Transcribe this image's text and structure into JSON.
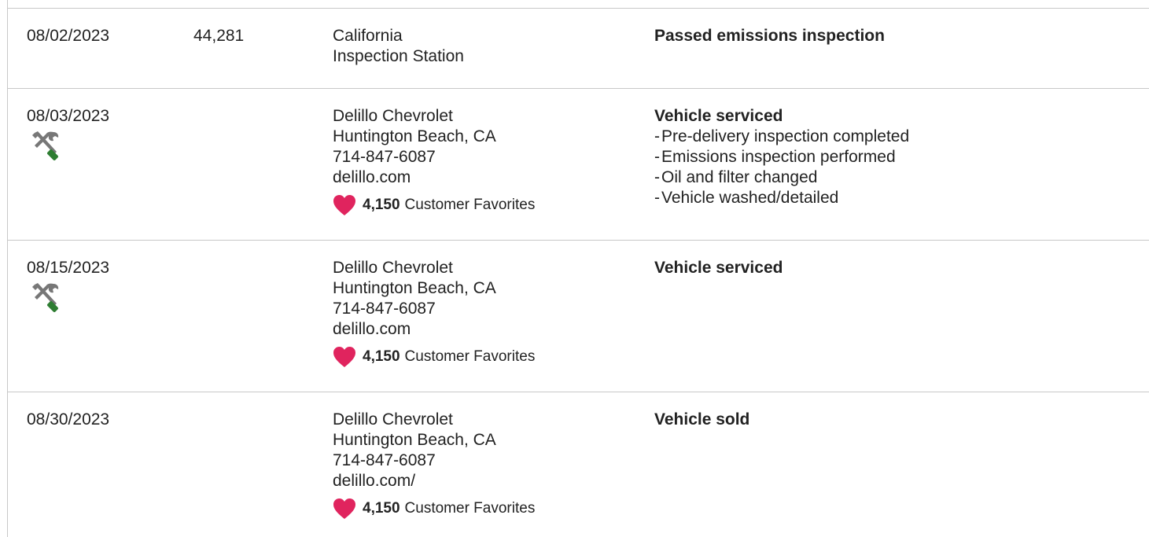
{
  "colors": {
    "heart": "#e0245e",
    "wrench_gray": "#777777",
    "screwdriver_green": "#2e7d32",
    "divider": "#c8c8c8"
  },
  "records": [
    {
      "date": "08/02/2023",
      "mileage": "44,281",
      "source": {
        "lines": [
          "California",
          "Inspection Station"
        ]
      },
      "headline": "Passed emissions inspection",
      "details": []
    },
    {
      "date": "08/03/2023",
      "icon": "wrench-screwdriver-icon",
      "mileage": "",
      "source": {
        "lines": [
          "Delillo Chevrolet",
          "Huntington Beach, CA",
          "714-847-6087",
          "delillo.com"
        ],
        "favorites_count": "4,150",
        "favorites_label": "Customer Favorites"
      },
      "headline": "Vehicle serviced",
      "details": [
        "Pre-delivery inspection completed",
        "Emissions inspection performed",
        "Oil and filter changed",
        "Vehicle washed/detailed"
      ]
    },
    {
      "date": "08/15/2023",
      "icon": "wrench-screwdriver-icon",
      "mileage": "",
      "source": {
        "lines": [
          "Delillo Chevrolet",
          "Huntington Beach, CA",
          "714-847-6087",
          "delillo.com"
        ],
        "favorites_count": "4,150",
        "favorites_label": "Customer Favorites"
      },
      "headline": "Vehicle serviced",
      "details": []
    },
    {
      "date": "08/30/2023",
      "mileage": "",
      "source": {
        "lines": [
          "Delillo Chevrolet",
          "Huntington Beach, CA",
          "714-847-6087",
          "delillo.com/"
        ],
        "favorites_count": "4,150",
        "favorites_label": "Customer Favorites"
      },
      "headline": "Vehicle sold",
      "details": []
    }
  ]
}
